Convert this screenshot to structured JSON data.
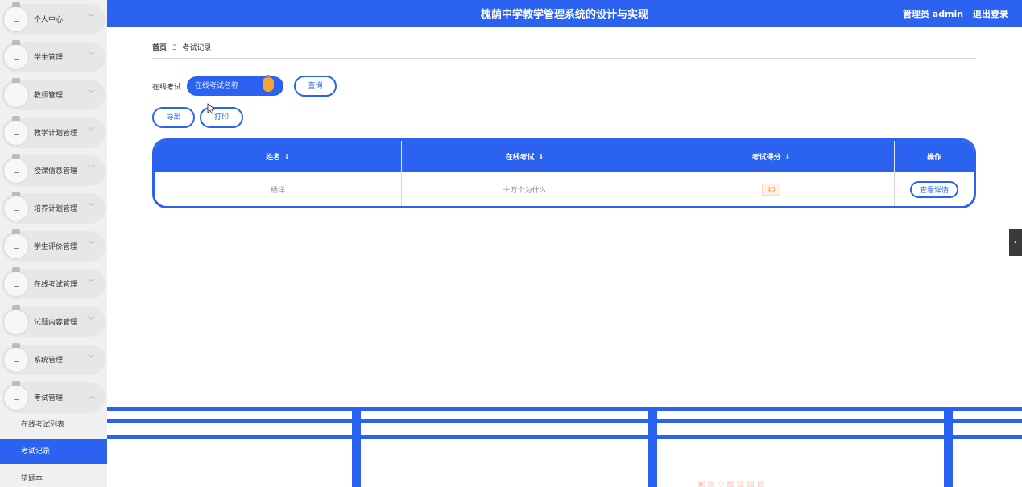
{
  "header": {
    "title": "槐荫中学教学管理系统的设计与实现",
    "user": "管理员 admin",
    "logout": "退出登录"
  },
  "sidebar": {
    "items": [
      {
        "label": "个人中心",
        "chevron": "﹀"
      },
      {
        "label": "学生管理",
        "chevron": "﹀"
      },
      {
        "label": "教师管理",
        "chevron": "﹀"
      },
      {
        "label": "教学计划管理",
        "chevron": "﹀"
      },
      {
        "label": "授课信息管理",
        "chevron": "﹀"
      },
      {
        "label": "培养计划管理",
        "chevron": "﹀"
      },
      {
        "label": "学生评价管理",
        "chevron": "﹀"
      },
      {
        "label": "在线考试管理",
        "chevron": "﹀"
      },
      {
        "label": "试题内容管理",
        "chevron": "﹀"
      },
      {
        "label": "系统管理",
        "chevron": "﹀"
      },
      {
        "label": "考试管理",
        "chevron": "︿"
      }
    ],
    "subitems": [
      {
        "label": "在线考试列表"
      },
      {
        "label": "考试记录"
      },
      {
        "label": "错题本"
      }
    ]
  },
  "breadcrumb": {
    "home": "首页",
    "separator": "Ξ",
    "current": "考试记录"
  },
  "search": {
    "label": "在线考试",
    "placeholder": "在线考试名称",
    "button": "查询"
  },
  "actions": {
    "export": "导出",
    "print": "打印"
  },
  "table": {
    "headers": [
      "姓名",
      "在线考试",
      "考试得分",
      "操作"
    ],
    "sort_glyph": "⇕",
    "rows": [
      {
        "name": "杨洋",
        "exam": "十万个为什么",
        "score": "40",
        "action": "查看详情"
      }
    ]
  },
  "collapse": "‹",
  "colors": {
    "primary": "#2b63f0",
    "sidebar_bg": "#f0f0f0",
    "badge": "#f5a531"
  }
}
